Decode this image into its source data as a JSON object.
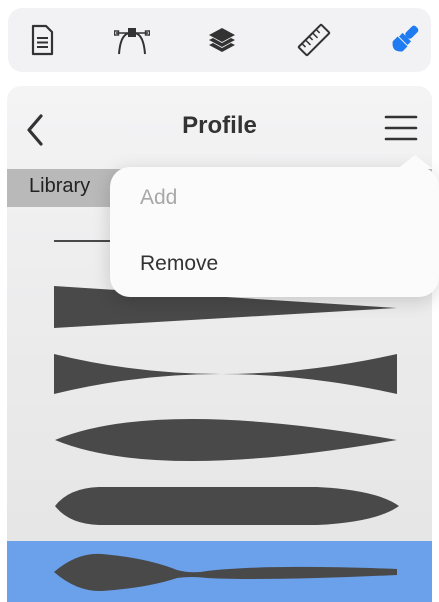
{
  "toolbar": {
    "tools": [
      {
        "icon": "document-icon"
      },
      {
        "icon": "bezier-pen-icon"
      },
      {
        "icon": "layers-icon"
      },
      {
        "icon": "ruler-icon"
      },
      {
        "icon": "brush-icon",
        "active": true,
        "color": "#1f7bf2"
      }
    ]
  },
  "panel": {
    "title": "Profile",
    "library_label": "Library"
  },
  "popover": {
    "items": [
      {
        "label": "Add",
        "enabled": false
      },
      {
        "label": "Remove",
        "enabled": true
      }
    ]
  },
  "profiles": [
    {
      "shape": "thin-line"
    },
    {
      "shape": "taper"
    },
    {
      "shape": "pinch"
    },
    {
      "shape": "lens"
    },
    {
      "shape": "rounded-taper"
    },
    {
      "shape": "wave",
      "selected": true
    }
  ],
  "colors": {
    "accent": "#1f7bf2",
    "selection": "#6aa1ea",
    "profile_fill": "#494949"
  }
}
